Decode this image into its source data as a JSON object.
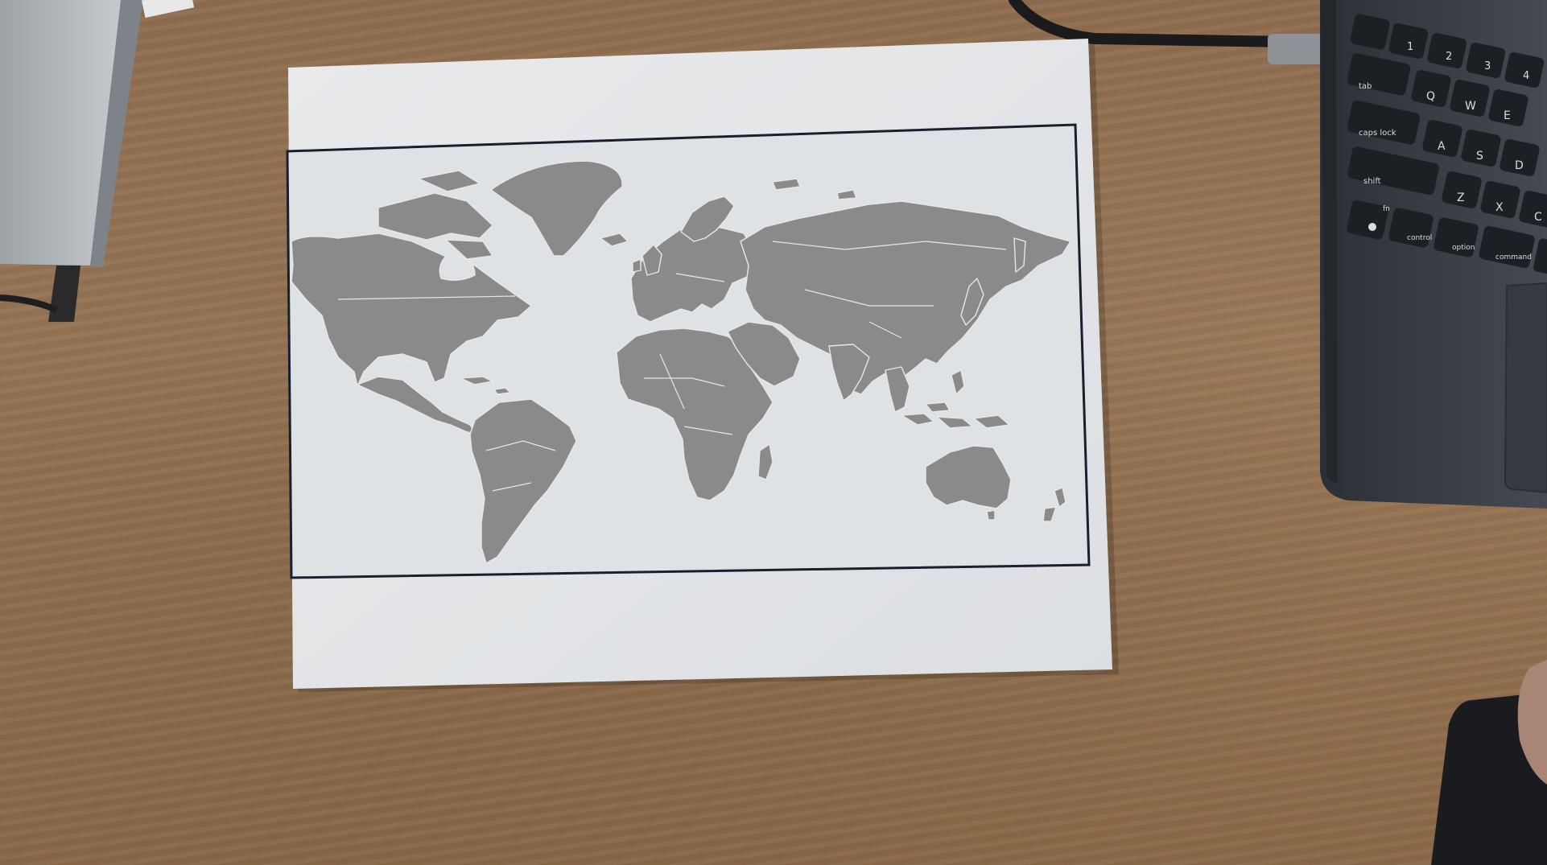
{
  "scene": {
    "description_tag": "photo-of-printed-world-map",
    "colors": {
      "desk": "#93704f",
      "paper": "#e4e6e8",
      "land": "#8a8a8c",
      "border": "#e7e7e7",
      "frame": "#1a1f2e",
      "laptop": "#3a3f46",
      "keys": "#1c1f24"
    }
  },
  "laptop": {
    "keys": {
      "tab": "tab",
      "caps": "caps lock",
      "shift": "shift",
      "fn": "fn",
      "control": "control",
      "option": "option",
      "command": "command",
      "q": "Q",
      "w": "W",
      "e": "E",
      "a": "A",
      "s": "S",
      "d": "D",
      "z": "Z",
      "x": "X",
      "c": "C",
      "n1": "1",
      "n2": "2",
      "n3": "3",
      "n4": "4"
    }
  }
}
